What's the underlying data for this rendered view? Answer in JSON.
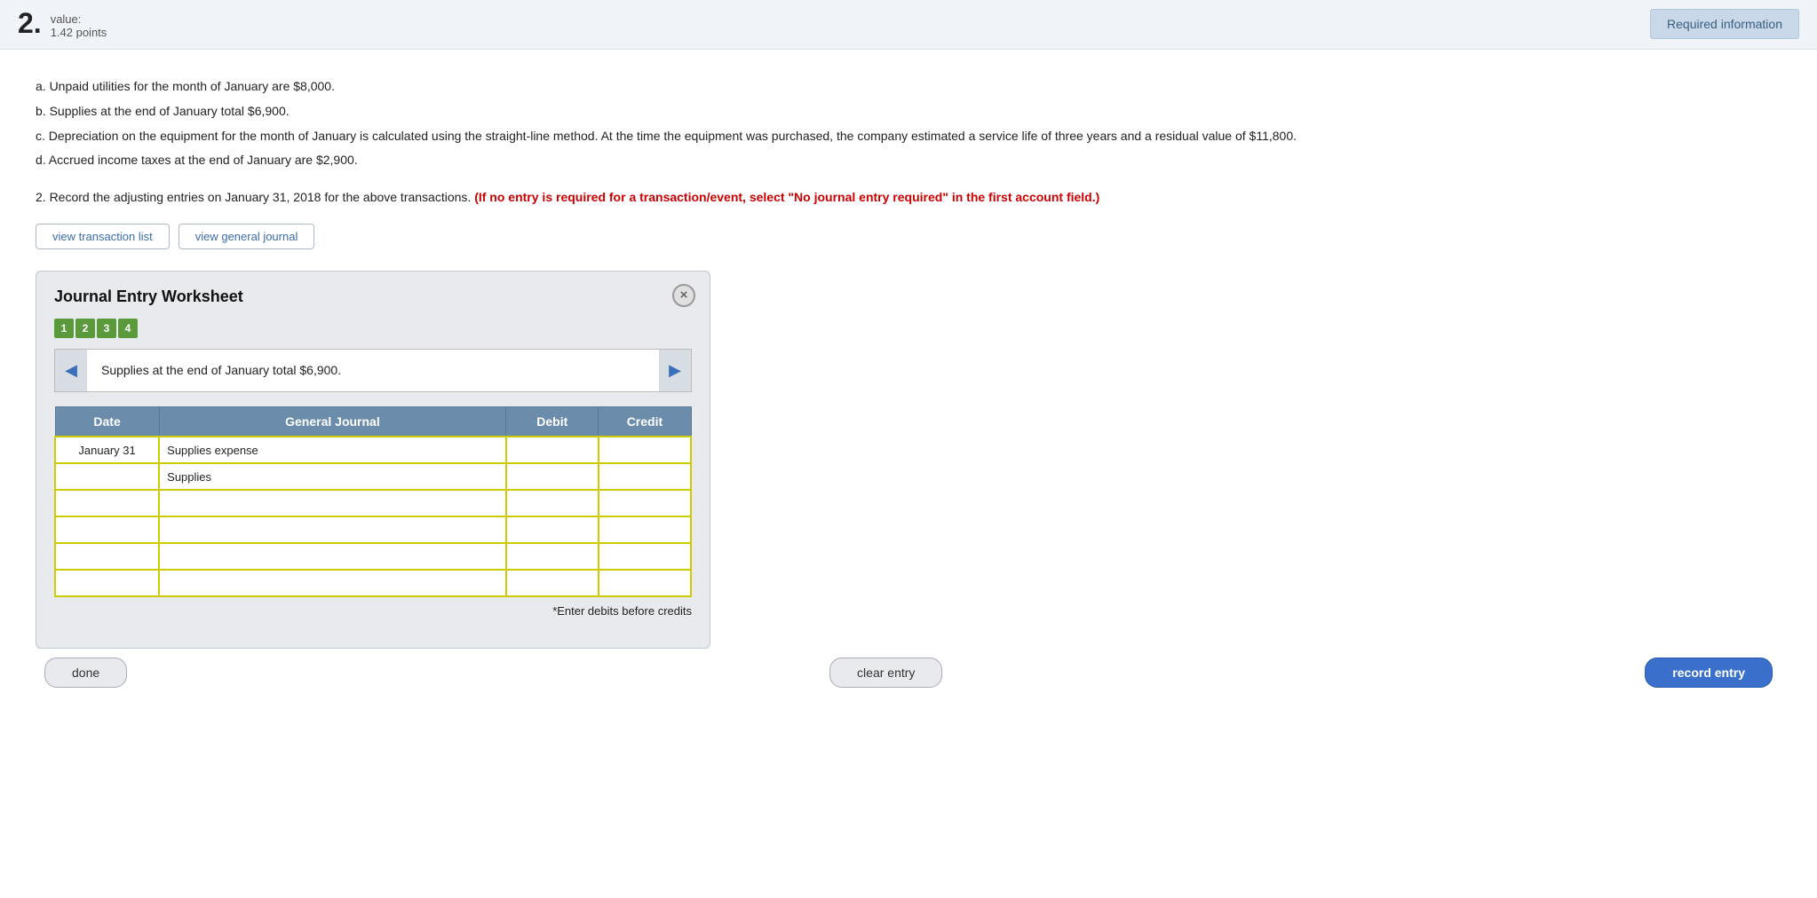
{
  "top": {
    "question_number": "2.",
    "value_label": "value:",
    "points": "1.42 points",
    "required_info_btn": "Required information"
  },
  "instructions": {
    "a": "a. Unpaid utilities for the month of January are $8,000.",
    "b": "b. Supplies at the end of January total $6,900.",
    "c": "c. Depreciation on the equipment for the month of January is calculated using the straight-line method. At the time the equipment was purchased, the company estimated a service life of three years and a residual value of $11,800.",
    "d": "d. Accrued income taxes at the end of January are $2,900."
  },
  "question_instruction_start": "2. Record the adjusting entries on January 31, 2018 for the above transactions.",
  "question_instruction_red": "(If no entry is required for a transaction/event, select \"No journal entry required\" in the first account field.)",
  "action_buttons": {
    "view_transaction_list": "view transaction list",
    "view_general_journal": "view general journal"
  },
  "worksheet": {
    "title": "Journal Entry Worksheet",
    "close_btn": "×",
    "steps": [
      "1",
      "2",
      "3",
      "4"
    ],
    "nav_text": "Supplies at the end of January total $6,900.",
    "table": {
      "headers": [
        "Date",
        "General Journal",
        "Debit",
        "Credit"
      ],
      "rows": [
        {
          "date": "January 31",
          "account": "Supplies expense",
          "debit": "",
          "credit": "",
          "indented": false
        },
        {
          "date": "",
          "account": "Supplies",
          "debit": "",
          "credit": "",
          "indented": true
        },
        {
          "date": "",
          "account": "",
          "debit": "",
          "credit": "",
          "indented": false
        },
        {
          "date": "",
          "account": "",
          "debit": "",
          "credit": "",
          "indented": false
        },
        {
          "date": "",
          "account": "",
          "debit": "",
          "credit": "",
          "indented": false
        },
        {
          "date": "",
          "account": "",
          "debit": "",
          "credit": "",
          "indented": false
        }
      ]
    },
    "enter_note": "*Enter debits before credits"
  },
  "bottom_buttons": {
    "done": "done",
    "clear_entry": "clear entry",
    "record_entry": "record entry"
  }
}
